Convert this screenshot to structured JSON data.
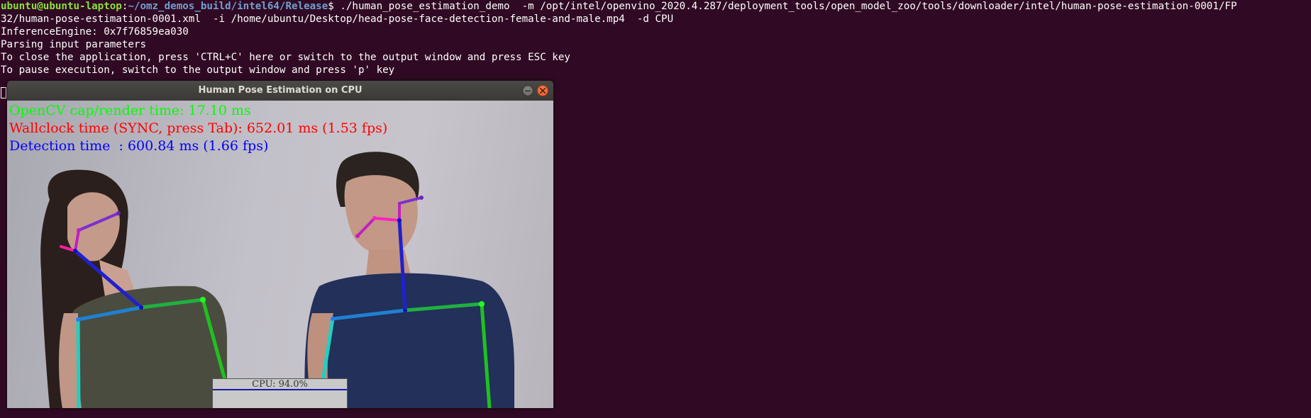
{
  "terminal": {
    "prompt_user": "ubuntu@ubuntu-laptop",
    "prompt_sep": ":",
    "prompt_path": "~/omz_demos_build/intel64/Release",
    "prompt_symbol": "$",
    "command_line_1": " ./human_pose_estimation_demo  -m /opt/intel/openvino_2020.4.287/deployment_tools/open_model_zoo/tools/downloader/intel/human-pose-estimation-0001/FP",
    "command_line_2": "32/human-pose-estimation-0001.xml  -i /home/ubuntu/Desktop/head-pose-face-detection-female-and-male.mp4  -d CPU",
    "output": [
      "InferenceEngine: 0x7f76859ea030",
      "Parsing input parameters",
      "To close the application, press 'CTRL+C' here or switch to the output window and press ESC key",
      "To pause execution, switch to the output window and press 'p' key"
    ]
  },
  "window": {
    "title": "Human Pose Estimation on CPU",
    "minimize_label": "–",
    "close_label": "×"
  },
  "overlay": {
    "render_time": "OpenCV cap/render time: 17.10 ms",
    "wallclock": "Wallclock time (SYNC, press Tab): 652.01 ms (1.53 fps)",
    "detection": "Detection time  : 600.84 ms (1.66 fps)",
    "cpu_label": "CPU: 94.0%",
    "cpu_usage_percent": 94.0
  },
  "colors": {
    "terminal_bg": "#300a24",
    "prompt_user": "#8ae234",
    "prompt_path": "#729fcf",
    "render_text": "#00ff00",
    "wallclock_text": "#ff0000",
    "detection_text": "#0000ff"
  },
  "icons": {
    "minimize": "minimize-icon",
    "close": "close-icon"
  }
}
